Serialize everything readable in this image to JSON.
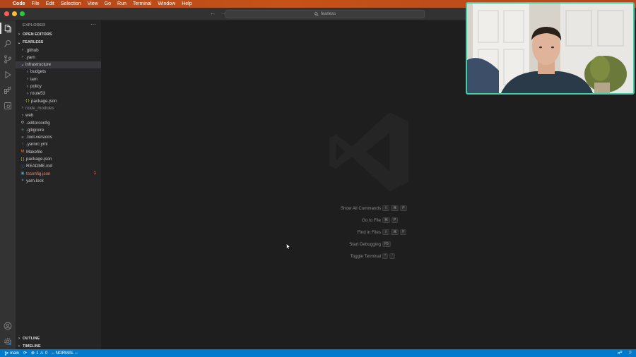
{
  "menubar": {
    "items": [
      "Code",
      "File",
      "Edit",
      "Selection",
      "View",
      "Go",
      "Run",
      "Terminal",
      "Window",
      "Help"
    ]
  },
  "titlebar": {
    "search_text": "fearless"
  },
  "sidebar": {
    "title": "EXPLORER",
    "more": "···",
    "open_editors": "OPEN EDITORS",
    "project": "FEARLESS",
    "tree": [
      {
        "label": ".github",
        "kind": "folder",
        "depth": 1,
        "expanded": false
      },
      {
        "label": ".yarn",
        "kind": "folder",
        "depth": 1,
        "expanded": false
      },
      {
        "label": "infrastructure",
        "kind": "folder",
        "depth": 1,
        "expanded": true,
        "selected": true
      },
      {
        "label": "budgets",
        "kind": "folder",
        "depth": 2,
        "expanded": false
      },
      {
        "label": "iam",
        "kind": "folder",
        "depth": 2,
        "expanded": false
      },
      {
        "label": "policy",
        "kind": "folder",
        "depth": 2,
        "expanded": false
      },
      {
        "label": "route53",
        "kind": "folder",
        "depth": 2,
        "expanded": false
      },
      {
        "label": "package.json",
        "kind": "json",
        "depth": 2
      },
      {
        "label": "node_modules",
        "kind": "folder",
        "depth": 1,
        "expanded": false,
        "dim": true
      },
      {
        "label": "web",
        "kind": "folder",
        "depth": 1,
        "expanded": false
      },
      {
        "label": ".editorconfig",
        "kind": "gear",
        "depth": 1
      },
      {
        "label": ".gitignore",
        "kind": "git",
        "depth": 1
      },
      {
        "label": ".tool-versions",
        "kind": "lines",
        "depth": 1
      },
      {
        "label": ".yarnrc.yml",
        "kind": "yaml",
        "depth": 1
      },
      {
        "label": "Makefile",
        "kind": "make",
        "depth": 1
      },
      {
        "label": "package.json",
        "kind": "json",
        "depth": 1
      },
      {
        "label": "README.md",
        "kind": "info",
        "depth": 1
      },
      {
        "label": "tsconfig.json",
        "kind": "ts",
        "depth": 1,
        "error": true,
        "badge": "1"
      },
      {
        "label": "yarn.lock",
        "kind": "yarn",
        "depth": 1
      }
    ],
    "outline": "OUTLINE",
    "timeline": "TIMELINE"
  },
  "editor": {
    "shortcuts": [
      {
        "label": "Show All Commands",
        "keys": [
          "⇧",
          "⌘",
          "P"
        ]
      },
      {
        "label": "Go to File",
        "keys": [
          "⌘",
          "P"
        ]
      },
      {
        "label": "Find in Files",
        "keys": [
          "⇧",
          "⌘",
          "F"
        ]
      },
      {
        "label": "Start Debugging",
        "keys": [
          "F5"
        ]
      },
      {
        "label": "Toggle Terminal",
        "keys": [
          "^",
          "`"
        ]
      }
    ]
  },
  "statusbar": {
    "branch": "main",
    "errors": "1",
    "warnings": "0",
    "mode": "-- NORMAL --"
  },
  "colors": {
    "accent": "#007acc",
    "menubar": "#c65218",
    "webcam_border": "#3fcfa5",
    "error": "#f48771"
  }
}
